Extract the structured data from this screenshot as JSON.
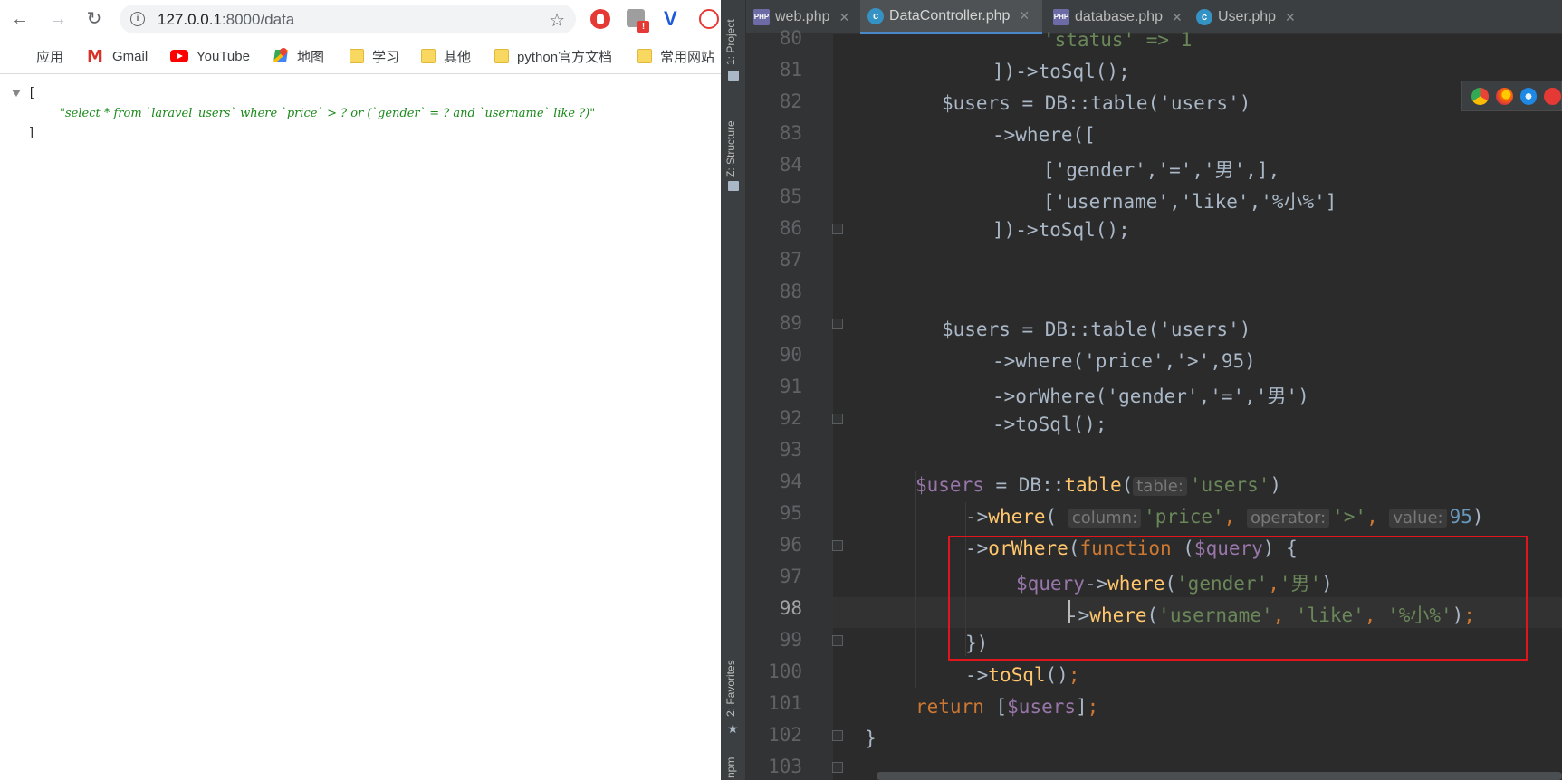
{
  "browser": {
    "url_host": "127.0.0.1",
    "url_rest": ":8000/data",
    "bookmarks": [
      "应用",
      "Gmail",
      "YouTube",
      "地图",
      "学习",
      "其他",
      "python官方文档",
      "常用网站"
    ],
    "json": {
      "open_bracket": "[",
      "value": "\"select * from `laravel_users` where `price` > ? or (`gender` = ? and `username` like ?)\"",
      "close_bracket": "]"
    }
  },
  "ide": {
    "side_tools": [
      "1: Project",
      "Z: Structure",
      "2: Favorites",
      "npm"
    ],
    "tabs": [
      "web.php",
      "DataController.php",
      "database.php",
      "User.php"
    ],
    "active_tab": "DataController.php",
    "line_numbers": [
      "80",
      "81",
      "82",
      "83",
      "84",
      "85",
      "86",
      "87",
      "88",
      "89",
      "90",
      "91",
      "92",
      "93",
      "94",
      "95",
      "96",
      "97",
      "98",
      "99",
      "100",
      "101",
      "102",
      "103"
    ],
    "current_line": "98",
    "code": {
      "l80": "'status' => 1",
      "l81": "])->toSql();",
      "l82": "$users = DB::table('users')",
      "l83": "->where([",
      "l84": "['gender','=','男',],",
      "l85": "['username','like','%小%']",
      "l86": "])->toSql();",
      "l89": "$users = DB::table('users')",
      "l90": "->where('price','>',95)",
      "l91": "->orWhere('gender','=','男')",
      "l92": "->toSql();",
      "l94_var": "$users",
      "l94_mid": " = DB::",
      "l94_fn": "table",
      "l94_hint": "table:",
      "l94_str": "'users'",
      "l95_fn": "where",
      "l95_hint1": "column:",
      "l95_str1": "'price'",
      "l95_hint2": "operator:",
      "l95_str2": "'>'",
      "l95_hint3": "value:",
      "l95_num": "95",
      "l96_fn": "orWhere",
      "l96_kw": "function",
      "l96_var": "$query",
      "l97_var": "$query",
      "l97_fn": "where",
      "l97_str1": "'gender'",
      "l97_str2": "'男'",
      "l98_fn": "where",
      "l98_str1": "'username'",
      "l98_str2": "'like'",
      "l98_str3": "'%小%'",
      "l99": "})",
      "l100_fn": "toSql",
      "l101_kw": "return",
      "l101_var": "$users",
      "l102": "}"
    }
  },
  "colors": {
    "highlight_box": "#e0161c",
    "active_tab_underline": "#4a88c7",
    "json_string": "#1a8a1a"
  }
}
